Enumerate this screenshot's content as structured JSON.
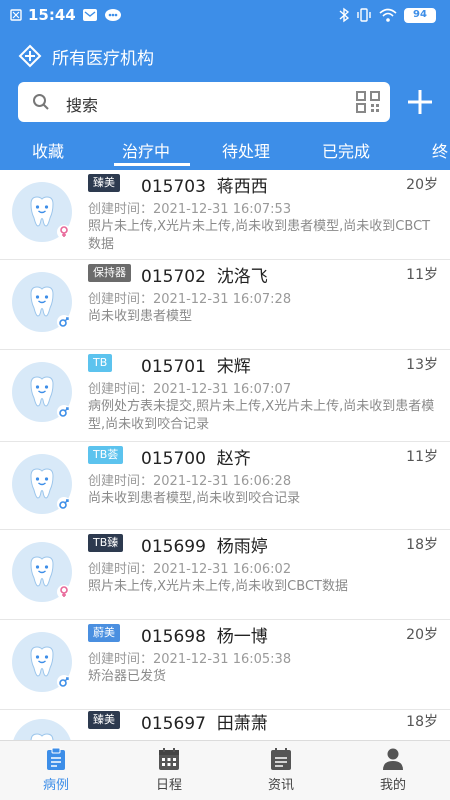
{
  "status_bar": {
    "time": "15:44",
    "battery": "94"
  },
  "header": {
    "title": "所有医疗机构"
  },
  "search": {
    "placeholder": "搜索"
  },
  "tabs": [
    {
      "label": "收藏"
    },
    {
      "label": "治疗中",
      "active": true
    },
    {
      "label": "待处理"
    },
    {
      "label": "已完成"
    },
    {
      "label": "终"
    }
  ],
  "created_label": "创建时间：",
  "patients": [
    {
      "badge": "臻美",
      "badge_color": "#2d3a4f",
      "id": "015703",
      "name": "蒋西西",
      "age": "20岁",
      "gender": "female",
      "created": "2021-12-31 16:07:53",
      "status": "照片未上传,X光片未上传,尚未收到患者模型,尚未收到CBCT数据"
    },
    {
      "badge": "保持器",
      "badge_color": "#6b6b6b",
      "id": "015702",
      "name": "沈洛飞",
      "age": "11岁",
      "gender": "male",
      "created": "2021-12-31 16:07:28",
      "status": "尚未收到患者模型"
    },
    {
      "badge": "TB",
      "badge_color": "#5cc3ee",
      "id": "015701",
      "name": "宋辉",
      "age": "13岁",
      "gender": "male",
      "created": "2021-12-31 16:07:07",
      "status": "病例处方表未提交,照片未上传,X光片未上传,尚未收到患者模型,尚未收到咬合记录"
    },
    {
      "badge": "TB荟",
      "badge_color": "#5cc3ee",
      "id": "015700",
      "name": "赵齐",
      "age": "11岁",
      "gender": "male",
      "created": "2021-12-31 16:06:28",
      "status": "尚未收到患者模型,尚未收到咬合记录"
    },
    {
      "badge": "TB臻",
      "badge_color": "#2d3a4f",
      "id": "015699",
      "name": "杨雨婷",
      "age": "18岁",
      "gender": "female",
      "created": "2021-12-31 16:06:02",
      "status": "照片未上传,X光片未上传,尚未收到CBCT数据"
    },
    {
      "badge": "蔚美",
      "badge_color": "#4a8fe0",
      "id": "015698",
      "name": "杨一博",
      "age": "20岁",
      "gender": "male",
      "created": "2021-12-31 16:05:38",
      "status": "矫治器已发货"
    },
    {
      "badge": "臻美",
      "badge_color": "#2d3a4f",
      "id": "015697",
      "name": "田萧萧",
      "age": "18岁",
      "gender": "female",
      "created": "",
      "status": ""
    }
  ],
  "bottom_nav": [
    {
      "label": "病例",
      "icon": "clipboard-icon",
      "active": true
    },
    {
      "label": "日程",
      "icon": "calendar-icon"
    },
    {
      "label": "资讯",
      "icon": "news-icon"
    },
    {
      "label": "我的",
      "icon": "person-icon"
    }
  ],
  "colors": {
    "primary": "#3d8ee8",
    "female": "#e8689a",
    "male": "#3d8ee8"
  }
}
